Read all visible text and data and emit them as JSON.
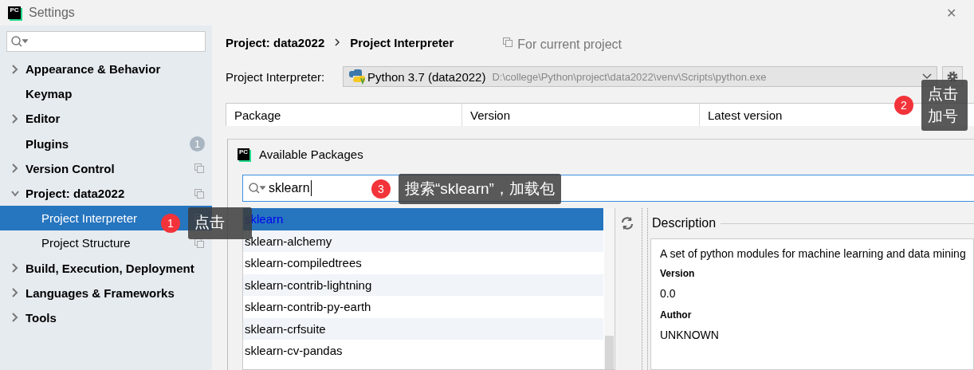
{
  "window": {
    "title": "Settings",
    "logo": "PC",
    "close": "✕"
  },
  "sidebar": {
    "items": [
      {
        "label": "Appearance & Behavior",
        "kind": "group",
        "expanded": false,
        "selected": false,
        "per_project": false
      },
      {
        "label": "Keymap",
        "kind": "page",
        "selected": false,
        "per_project": false
      },
      {
        "label": "Editor",
        "kind": "group",
        "expanded": false,
        "selected": false,
        "per_project": false
      },
      {
        "label": "Plugins",
        "kind": "page",
        "selected": false,
        "per_project": false,
        "badge": "1"
      },
      {
        "label": "Version Control",
        "kind": "group",
        "expanded": false,
        "selected": false,
        "per_project": true
      },
      {
        "label": "Project: data2022",
        "kind": "group",
        "expanded": true,
        "selected": false,
        "per_project": true,
        "children": [
          {
            "label": "Project Interpreter",
            "selected": true,
            "per_project": true
          },
          {
            "label": "Project Structure",
            "selected": false,
            "per_project": true
          }
        ]
      },
      {
        "label": "Build, Execution, Deployment",
        "kind": "group",
        "expanded": false,
        "selected": false,
        "per_project": false
      },
      {
        "label": "Languages & Frameworks",
        "kind": "group",
        "expanded": false,
        "selected": false,
        "per_project": false
      },
      {
        "label": "Tools",
        "kind": "group",
        "expanded": false,
        "selected": false,
        "per_project": false
      }
    ]
  },
  "breadcrumb": [
    "Project: data2022",
    "Project Interpreter"
  ],
  "scope_note": "For current project",
  "interpreter": {
    "label": "Project Interpreter:",
    "name": "Python 3.7 (data2022)",
    "path": "D:\\college\\Python\\project\\data2022\\venv\\Scripts\\python.exe"
  },
  "table": {
    "columns": [
      "Package",
      "Version",
      "Latest version"
    ]
  },
  "dialog": {
    "title": "Available Packages",
    "logo": "PC",
    "search": {
      "value": "sklearn"
    },
    "packages": [
      {
        "name": "sklearn",
        "selected": true
      },
      {
        "name": "sklearn-alchemy",
        "selected": false
      },
      {
        "name": "sklearn-compiledtrees",
        "selected": false
      },
      {
        "name": "sklearn-contrib-lightning",
        "selected": false
      },
      {
        "name": "sklearn-contrib-py-earth",
        "selected": false
      },
      {
        "name": "sklearn-crfsuite",
        "selected": false
      },
      {
        "name": "sklearn-cv-pandas",
        "selected": false
      }
    ],
    "description": {
      "heading": "Description",
      "text": "A set of python modules for machine learning and data mining",
      "fields": [
        {
          "label": "Version",
          "value": "0.0"
        },
        {
          "label": "Author",
          "value": "UNKNOWN"
        }
      ]
    }
  },
  "annotations": [
    {
      "number": "1",
      "text": "点击"
    },
    {
      "number": "2",
      "text": "点击加号"
    },
    {
      "number": "3",
      "text": "搜索“sklearn”，加载包"
    }
  ]
}
